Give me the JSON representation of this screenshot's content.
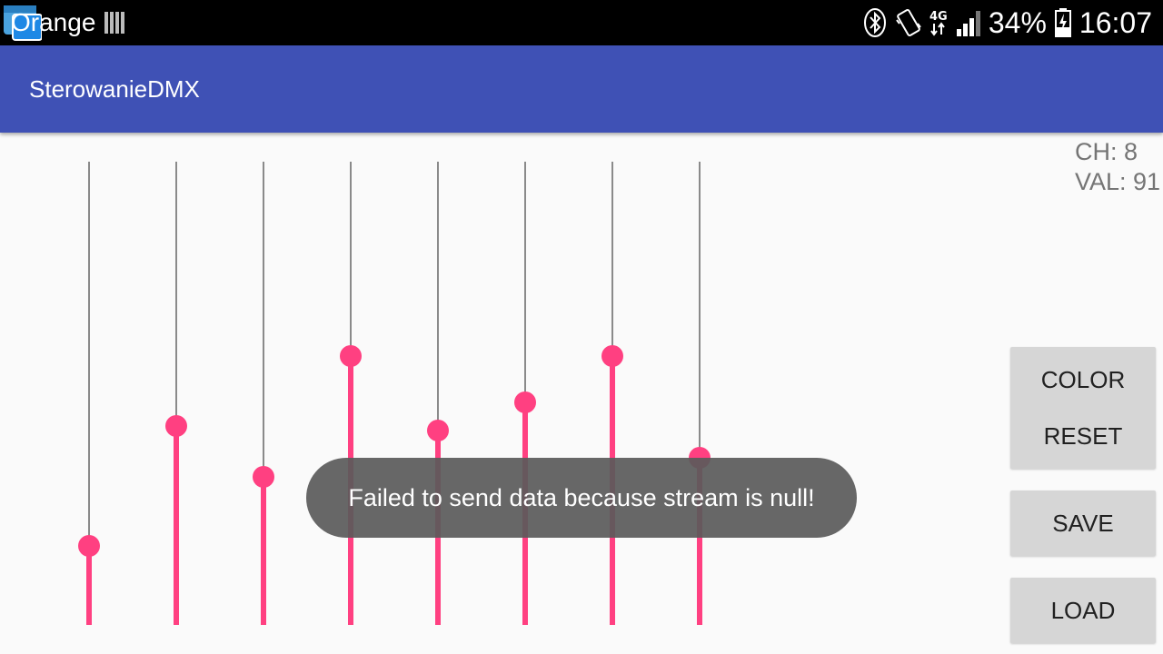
{
  "status_bar": {
    "carrier": "Orange",
    "battery": "34%",
    "time": "16:07",
    "network": "4G",
    "icons": [
      "notification-icon",
      "signal-bars-icon",
      "bluetooth-icon",
      "vibrate-icon",
      "network-4g-icon",
      "cell-signal-icon",
      "battery-charging-icon"
    ]
  },
  "app_bar": {
    "title": "SterowanieDMX"
  },
  "readout": {
    "channel": "CH: 8",
    "value": "VAL: 91"
  },
  "sliders": [
    {
      "channel": 1,
      "level": 0.17
    },
    {
      "channel": 2,
      "level": 0.43
    },
    {
      "channel": 3,
      "level": 0.32
    },
    {
      "channel": 4,
      "level": 0.58
    },
    {
      "channel": 5,
      "level": 0.42
    },
    {
      "channel": 6,
      "level": 0.48
    },
    {
      "channel": 7,
      "level": 0.58
    },
    {
      "channel": 8,
      "level": 0.36
    }
  ],
  "buttons": {
    "color": "COLOR",
    "reset": "RESET",
    "save": "SAVE",
    "load": "LOAD"
  },
  "toast": {
    "message": "Failed to send data because stream is null!"
  },
  "colors": {
    "accent": "#ff4081",
    "primary": "#3f51b5",
    "background": "#fafafa"
  }
}
